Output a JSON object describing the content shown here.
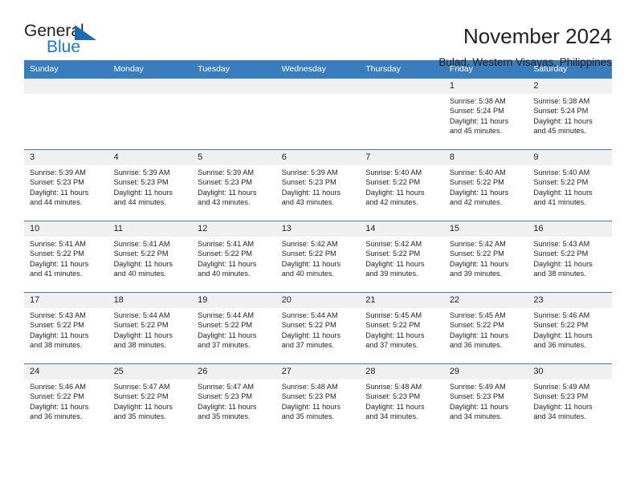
{
  "brand": {
    "name_top": "General",
    "name_bottom": "Blue",
    "triangle_color": "#1b6cb0",
    "blue_color": "#1a7bc4"
  },
  "header": {
    "title": "November 2024",
    "subtitle": "Bulad, Western Visayas, Philippines"
  },
  "theme": {
    "header_bg": "#3a7dbf",
    "daynum_bg": "#f0f0f0",
    "text": "#231f20"
  },
  "weekdays": [
    "Sunday",
    "Monday",
    "Tuesday",
    "Wednesday",
    "Thursday",
    "Friday",
    "Saturday"
  ],
  "weeks": [
    [
      {
        "day": "",
        "lines": []
      },
      {
        "day": "",
        "lines": []
      },
      {
        "day": "",
        "lines": []
      },
      {
        "day": "",
        "lines": []
      },
      {
        "day": "",
        "lines": []
      },
      {
        "day": "1",
        "lines": [
          "Sunrise: 5:38 AM",
          "Sunset: 5:24 PM",
          "Daylight: 11 hours",
          "and 45 minutes."
        ]
      },
      {
        "day": "2",
        "lines": [
          "Sunrise: 5:38 AM",
          "Sunset: 5:24 PM",
          "Daylight: 11 hours",
          "and 45 minutes."
        ]
      }
    ],
    [
      {
        "day": "3",
        "lines": [
          "Sunrise: 5:39 AM",
          "Sunset: 5:23 PM",
          "Daylight: 11 hours",
          "and 44 minutes."
        ]
      },
      {
        "day": "4",
        "lines": [
          "Sunrise: 5:39 AM",
          "Sunset: 5:23 PM",
          "Daylight: 11 hours",
          "and 44 minutes."
        ]
      },
      {
        "day": "5",
        "lines": [
          "Sunrise: 5:39 AM",
          "Sunset: 5:23 PM",
          "Daylight: 11 hours",
          "and 43 minutes."
        ]
      },
      {
        "day": "6",
        "lines": [
          "Sunrise: 5:39 AM",
          "Sunset: 5:23 PM",
          "Daylight: 11 hours",
          "and 43 minutes."
        ]
      },
      {
        "day": "7",
        "lines": [
          "Sunrise: 5:40 AM",
          "Sunset: 5:22 PM",
          "Daylight: 11 hours",
          "and 42 minutes."
        ]
      },
      {
        "day": "8",
        "lines": [
          "Sunrise: 5:40 AM",
          "Sunset: 5:22 PM",
          "Daylight: 11 hours",
          "and 42 minutes."
        ]
      },
      {
        "day": "9",
        "lines": [
          "Sunrise: 5:40 AM",
          "Sunset: 5:22 PM",
          "Daylight: 11 hours",
          "and 41 minutes."
        ]
      }
    ],
    [
      {
        "day": "10",
        "lines": [
          "Sunrise: 5:41 AM",
          "Sunset: 5:22 PM",
          "Daylight: 11 hours",
          "and 41 minutes."
        ]
      },
      {
        "day": "11",
        "lines": [
          "Sunrise: 5:41 AM",
          "Sunset: 5:22 PM",
          "Daylight: 11 hours",
          "and 40 minutes."
        ]
      },
      {
        "day": "12",
        "lines": [
          "Sunrise: 5:41 AM",
          "Sunset: 5:22 PM",
          "Daylight: 11 hours",
          "and 40 minutes."
        ]
      },
      {
        "day": "13",
        "lines": [
          "Sunrise: 5:42 AM",
          "Sunset: 5:22 PM",
          "Daylight: 11 hours",
          "and 40 minutes."
        ]
      },
      {
        "day": "14",
        "lines": [
          "Sunrise: 5:42 AM",
          "Sunset: 5:22 PM",
          "Daylight: 11 hours",
          "and 39 minutes."
        ]
      },
      {
        "day": "15",
        "lines": [
          "Sunrise: 5:42 AM",
          "Sunset: 5:22 PM",
          "Daylight: 11 hours",
          "and 39 minutes."
        ]
      },
      {
        "day": "16",
        "lines": [
          "Sunrise: 5:43 AM",
          "Sunset: 5:22 PM",
          "Daylight: 11 hours",
          "and 38 minutes."
        ]
      }
    ],
    [
      {
        "day": "17",
        "lines": [
          "Sunrise: 5:43 AM",
          "Sunset: 5:22 PM",
          "Daylight: 11 hours",
          "and 38 minutes."
        ]
      },
      {
        "day": "18",
        "lines": [
          "Sunrise: 5:44 AM",
          "Sunset: 5:22 PM",
          "Daylight: 11 hours",
          "and 38 minutes."
        ]
      },
      {
        "day": "19",
        "lines": [
          "Sunrise: 5:44 AM",
          "Sunset: 5:22 PM",
          "Daylight: 11 hours",
          "and 37 minutes."
        ]
      },
      {
        "day": "20",
        "lines": [
          "Sunrise: 5:44 AM",
          "Sunset: 5:22 PM",
          "Daylight: 11 hours",
          "and 37 minutes."
        ]
      },
      {
        "day": "21",
        "lines": [
          "Sunrise: 5:45 AM",
          "Sunset: 5:22 PM",
          "Daylight: 11 hours",
          "and 37 minutes."
        ]
      },
      {
        "day": "22",
        "lines": [
          "Sunrise: 5:45 AM",
          "Sunset: 5:22 PM",
          "Daylight: 11 hours",
          "and 36 minutes."
        ]
      },
      {
        "day": "23",
        "lines": [
          "Sunrise: 5:46 AM",
          "Sunset: 5:22 PM",
          "Daylight: 11 hours",
          "and 36 minutes."
        ]
      }
    ],
    [
      {
        "day": "24",
        "lines": [
          "Sunrise: 5:46 AM",
          "Sunset: 5:22 PM",
          "Daylight: 11 hours",
          "and 36 minutes."
        ]
      },
      {
        "day": "25",
        "lines": [
          "Sunrise: 5:47 AM",
          "Sunset: 5:22 PM",
          "Daylight: 11 hours",
          "and 35 minutes."
        ]
      },
      {
        "day": "26",
        "lines": [
          "Sunrise: 5:47 AM",
          "Sunset: 5:23 PM",
          "Daylight: 11 hours",
          "and 35 minutes."
        ]
      },
      {
        "day": "27",
        "lines": [
          "Sunrise: 5:48 AM",
          "Sunset: 5:23 PM",
          "Daylight: 11 hours",
          "and 35 minutes."
        ]
      },
      {
        "day": "28",
        "lines": [
          "Sunrise: 5:48 AM",
          "Sunset: 5:23 PM",
          "Daylight: 11 hours",
          "and 34 minutes."
        ]
      },
      {
        "day": "29",
        "lines": [
          "Sunrise: 5:49 AM",
          "Sunset: 5:23 PM",
          "Daylight: 11 hours",
          "and 34 minutes."
        ]
      },
      {
        "day": "30",
        "lines": [
          "Sunrise: 5:49 AM",
          "Sunset: 5:23 PM",
          "Daylight: 11 hours",
          "and 34 minutes."
        ]
      }
    ]
  ]
}
